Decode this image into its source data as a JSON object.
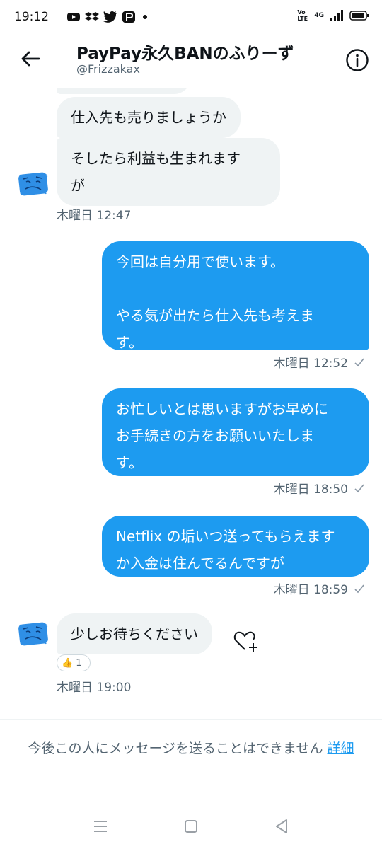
{
  "status_bar": {
    "time": "19:12",
    "icons": [
      "youtube-icon",
      "dropbox-icon",
      "twitter-icon",
      "paypay-icon"
    ],
    "right": {
      "volte": "Vo LTE",
      "network": "4G"
    }
  },
  "header": {
    "title": "PayPay永久BANのふりーず",
    "handle": "@Frizzakax"
  },
  "messages": [
    {
      "id": "m1",
      "direction": "in",
      "text": "仕入先も売りましょうか"
    },
    {
      "id": "m2",
      "direction": "in",
      "text": "そしたら利益も生まれます\nが",
      "timestamp": "木曜日 12:47"
    },
    {
      "id": "m3",
      "direction": "out",
      "text": "今回は自分用で使います。\n\nやる気が出たら仕入先も考えま\nす。",
      "timestamp": "木曜日 12:52"
    },
    {
      "id": "m4",
      "direction": "out",
      "text": "お忙しいとは思いますがお早めに\nお手続きの方をお願いいたしま\nす。",
      "timestamp": "木曜日 18:50"
    },
    {
      "id": "m5",
      "direction": "out",
      "text": "Netflix の垢いつ送ってもらえます\nか入金は住んでるんですが",
      "timestamp": "木曜日 18:59"
    },
    {
      "id": "m6",
      "direction": "in",
      "text": "少しお待ちください",
      "timestamp": "木曜日 19:00",
      "reaction": {
        "emoji": "👍",
        "count": "1"
      }
    }
  ],
  "footer": {
    "notice": "今後この人にメッセージを送ることはできません",
    "link": "詳細"
  },
  "colors": {
    "accent": "#1d9bf0",
    "incoming_bubble": "#eff3f4",
    "secondary_text": "#536471"
  }
}
